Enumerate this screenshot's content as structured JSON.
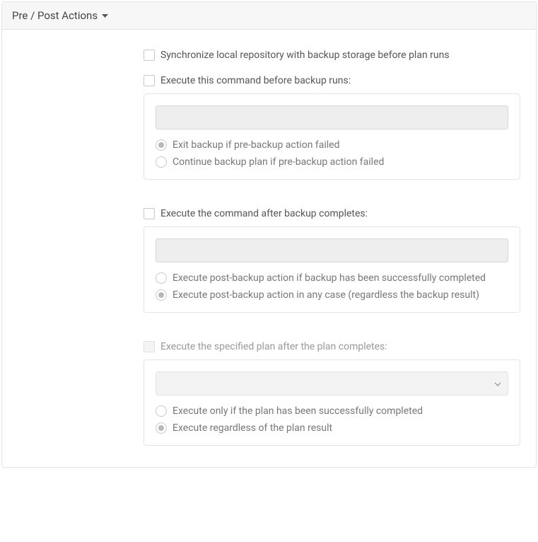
{
  "header": {
    "title": "Pre / Post Actions"
  },
  "sync": {
    "label": "Synchronize local repository with backup storage before plan runs"
  },
  "pre": {
    "checkbox_label": "Execute this command before backup runs:",
    "command_value": "",
    "radio_exit": "Exit backup if pre-backup action failed",
    "radio_continue": "Continue backup plan if pre-backup action failed"
  },
  "post": {
    "checkbox_label": "Execute the command after backup completes:",
    "command_value": "",
    "radio_success": "Execute post-backup action if backup has been successfully completed",
    "radio_any": "Execute post-backup action in any case (regardless the backup result)"
  },
  "chain": {
    "checkbox_label": "Execute the specified plan after the plan completes:",
    "select_value": "",
    "radio_success": "Execute only if the plan has been successfully completed",
    "radio_any": "Execute regardless of the plan result"
  }
}
